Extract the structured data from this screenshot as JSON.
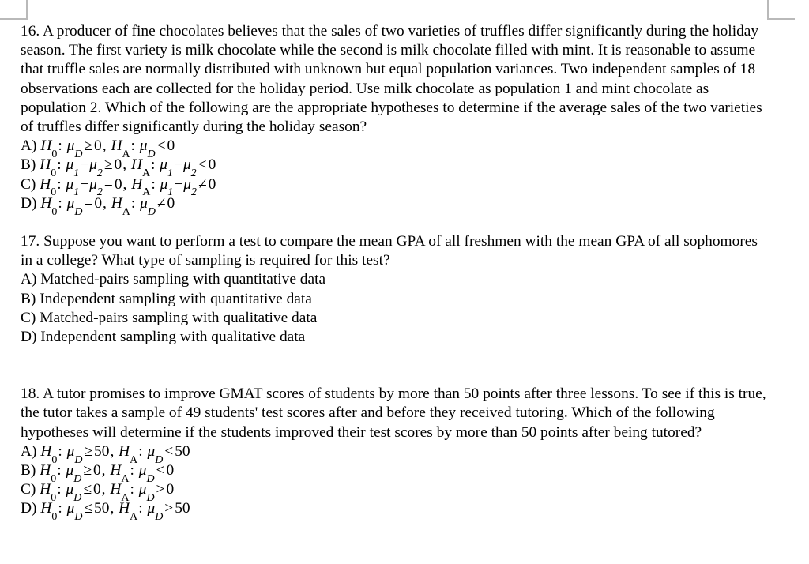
{
  "page": {
    "background_color": "#ffffff",
    "text_color": "#000000",
    "corner_mark_color": "#b9b9b9"
  },
  "questions": [
    {
      "number": "16.",
      "stem": "16. A producer of fine chocolates believes that the sales of two varieties of truffles differ significantly during the holiday season. The first variety is milk chocolate while the second is milk chocolate filled with mint. It is reasonable to assume that truffle sales are normally distributed with unknown but equal population variances. Two independent samples of 18 observations each are collected for the holiday period. Use milk chocolate as population 1 and mint chocolate as population 2. Which of the following are the appropriate hypotheses to determine if the average sales of the two varieties of truffles differ significantly during the holiday season?",
      "choices": [
        {
          "label": "A)",
          "text": "H0: μD ≥ 0, HA: μD < 0",
          "null_hyp": {
            "symbol": "H",
            "sub": "0",
            "param": "μ",
            "param_sub": "D",
            "relation": "≥",
            "value": "0"
          },
          "alt_hyp": {
            "symbol": "H",
            "sub": "A",
            "param": "μ",
            "param_sub": "D",
            "relation": "<",
            "value": "0"
          }
        },
        {
          "label": "B)",
          "text": "H0: μ1 − μ2 ≥ 0, HA: μ1 − μ2 < 0",
          "null_hyp": {
            "symbol": "H",
            "sub": "0",
            "param": "μ",
            "param_sub": "1",
            "param2": "μ",
            "param2_sub": "2",
            "operator": "−",
            "relation": "≥",
            "value": "0"
          },
          "alt_hyp": {
            "symbol": "H",
            "sub": "A",
            "param": "μ",
            "param_sub": "1",
            "param2": "μ",
            "param2_sub": "2",
            "operator": "−",
            "relation": "<",
            "value": "0"
          }
        },
        {
          "label": "C)",
          "text": "H0: μ1 − μ2 = 0, HA: μ1 − μ2 ≠ 0",
          "null_hyp": {
            "symbol": "H",
            "sub": "0",
            "param": "μ",
            "param_sub": "1",
            "param2": "μ",
            "param2_sub": "2",
            "operator": "−",
            "relation": "=",
            "value": "0"
          },
          "alt_hyp": {
            "symbol": "H",
            "sub": "A",
            "param": "μ",
            "param_sub": "1",
            "param2": "μ",
            "param2_sub": "2",
            "operator": "−",
            "relation": "≠",
            "value": "0"
          }
        },
        {
          "label": "D)",
          "text": "H0: μD = 0, HA: μD ≠ 0",
          "null_hyp": {
            "symbol": "H",
            "sub": "0",
            "param": "μ",
            "param_sub": "D",
            "relation": "=",
            "value": "0"
          },
          "alt_hyp": {
            "symbol": "H",
            "sub": "A",
            "param": "μ",
            "param_sub": "D",
            "relation": "≠",
            "value": "0"
          }
        }
      ]
    },
    {
      "number": "17.",
      "stem": "17. Suppose you want to perform a test to compare the mean GPA of all freshmen with the mean GPA of all sophomores in a college? What type of sampling is required for this test?",
      "choices": [
        {
          "label": "A)",
          "text": "A) Matched-pairs sampling with quantitative data"
        },
        {
          "label": "B)",
          "text": "B) Independent sampling with quantitative data"
        },
        {
          "label": "C)",
          "text": "C) Matched-pairs sampling with qualitative data"
        },
        {
          "label": "D)",
          "text": "D) Independent sampling with qualitative data"
        }
      ]
    },
    {
      "number": "18.",
      "stem": "18. A tutor promises to improve GMAT scores of students by more than 50 points after three lessons. To see if this is true, the tutor takes a sample of 49 students' test scores after and before they received tutoring.  Which of the following hypotheses will determine if the students improved their test scores by more than 50 points after being tutored?",
      "choices": [
        {
          "label": "A)",
          "text": "H0: μD ≥ 50, HA: μD < 50",
          "null_hyp": {
            "symbol": "H",
            "sub": "0",
            "param": "μ",
            "param_sub": "D",
            "relation": "≥",
            "value": "50"
          },
          "alt_hyp": {
            "symbol": "H",
            "sub": "A",
            "param": "μ",
            "param_sub": "D",
            "relation": "<",
            "value": "50"
          }
        },
        {
          "label": "B)",
          "text": "H0: μD ≥ 0, HA: μD < 0",
          "null_hyp": {
            "symbol": "H",
            "sub": "0",
            "param": "μ",
            "param_sub": "D",
            "relation": "≥",
            "value": "0"
          },
          "alt_hyp": {
            "symbol": "H",
            "sub": "A",
            "param": "μ",
            "param_sub": "D",
            "relation": "<",
            "value": "0"
          }
        },
        {
          "label": "C)",
          "text": "H0: μD ≤ 0, HA: μD > 0",
          "null_hyp": {
            "symbol": "H",
            "sub": "0",
            "param": "μ",
            "param_sub": "D",
            "relation": "≤",
            "value": "0"
          },
          "alt_hyp": {
            "symbol": "H",
            "sub": "A",
            "param": "μ",
            "param_sub": "D",
            "relation": ">",
            "value": "0"
          }
        },
        {
          "label": "D)",
          "text": "H0: μD ≤ 50, HA: μD > 50",
          "null_hyp": {
            "symbol": "H",
            "sub": "0",
            "param": "μ",
            "param_sub": "D",
            "relation": "≤",
            "value": "50"
          },
          "alt_hyp": {
            "symbol": "H",
            "sub": "A",
            "param": "μ",
            "param_sub": "D",
            "relation": ">",
            "value": "50"
          }
        }
      ]
    }
  ],
  "separators": {
    "comma": ", ",
    "colon": ": "
  }
}
